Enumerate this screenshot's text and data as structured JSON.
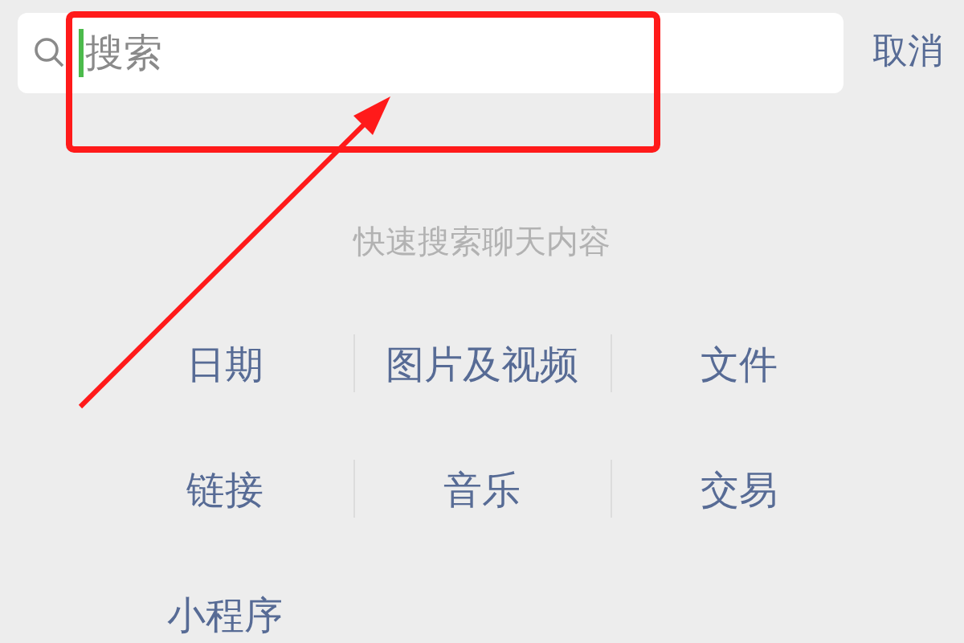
{
  "search": {
    "placeholder": "搜索",
    "focused": true
  },
  "cancel": "取消",
  "hint": "快速搜索聊天内容",
  "categories": [
    "日期",
    "图片及视频",
    "文件",
    "链接",
    "音乐",
    "交易",
    "小程序"
  ]
}
